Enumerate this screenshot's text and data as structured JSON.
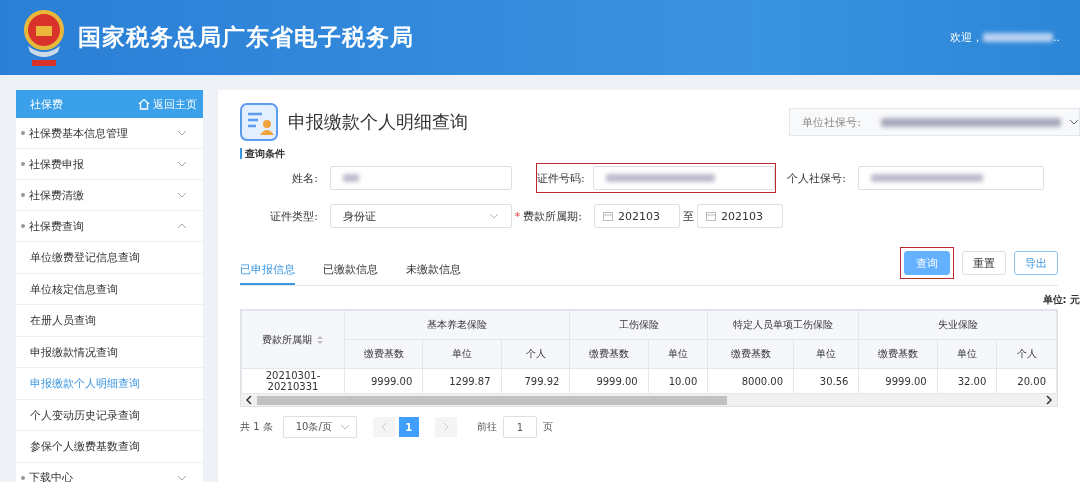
{
  "header": {
    "title": "国家税务总局广东省电子税务局",
    "welcome": "欢迎，",
    "user_blurred": true,
    "ellipsis": ".."
  },
  "sidebar": {
    "title": "社保费",
    "home_link": "返回主页",
    "items": [
      {
        "label": "社保费基本信息管理",
        "expanded": false
      },
      {
        "label": "社保费申报",
        "expanded": false
      },
      {
        "label": "社保费清缴",
        "expanded": false
      },
      {
        "label": "社保费查询",
        "expanded": true,
        "children": [
          {
            "label": "单位缴费登记信息查询",
            "selected": false
          },
          {
            "label": "单位核定信息查询",
            "selected": false
          },
          {
            "label": "在册人员查询",
            "selected": false
          },
          {
            "label": "申报缴款情况查询",
            "selected": false
          },
          {
            "label": "申报缴款个人明细查询",
            "selected": true
          },
          {
            "label": "个人变动历史记录查询",
            "selected": false
          },
          {
            "label": "参保个人缴费基数查询",
            "selected": false
          }
        ]
      },
      {
        "label": "下载中心",
        "expanded": false
      }
    ]
  },
  "page": {
    "title": "申报缴款个人明细查询",
    "unit_label": "单位社保号:",
    "unit_blurred": true
  },
  "query": {
    "section_title": "查询条件",
    "fields": [
      {
        "kind": "text",
        "label": "姓名:",
        "blurred": true,
        "highlighted": false,
        "required": false
      },
      {
        "kind": "text",
        "label": "证件号码:",
        "blurred": true,
        "highlighted": true,
        "required": false
      },
      {
        "kind": "text",
        "label": "个人社保号:",
        "blurred": true,
        "highlighted": false,
        "required": false
      },
      {
        "kind": "select",
        "label": "证件类型:",
        "value": "身份证",
        "highlighted": false,
        "required": false
      },
      {
        "kind": "range",
        "label": "费款所属期:",
        "from": "202103",
        "separator": "至",
        "to": "202103",
        "highlighted": false,
        "required": true,
        "required_mark": "*"
      }
    ]
  },
  "tabs": [
    {
      "label": "已申报信息",
      "selected": true
    },
    {
      "label": "已缴款信息",
      "selected": false
    },
    {
      "label": "未缴款信息",
      "selected": false
    }
  ],
  "buttons": [
    {
      "label": "查询",
      "kind": "primary",
      "highlighted": true
    },
    {
      "label": "重置",
      "kind": "default",
      "highlighted": false
    },
    {
      "label": "导出",
      "kind": "outline",
      "highlighted": false
    }
  ],
  "unit_note": "单位: 元",
  "table": {
    "first_column": "费款所属期",
    "groups": [
      {
        "label": "基本养老保险",
        "columns": [
          "缴费基数",
          "单位",
          "个人"
        ]
      },
      {
        "label": "工伤保险",
        "columns": [
          "缴费基数",
          "单位"
        ]
      },
      {
        "label": "特定人员单项工伤保险",
        "columns": [
          "缴费基数",
          "单位"
        ]
      },
      {
        "label": "失业保险",
        "columns": [
          "缴费基数",
          "单位",
          "个人"
        ]
      }
    ],
    "rows": [
      [
        "20210301-20210331",
        "9999.00",
        "1299.87",
        "799.92",
        "9999.00",
        "10.00",
        "8000.00",
        "30.56",
        "9999.00",
        "32.00",
        "20.00"
      ]
    ]
  },
  "pagination": {
    "total": "共 1 条",
    "page_size": "10条/页",
    "pages": [
      {
        "label": "1",
        "selected": true
      }
    ],
    "goto_label": "前往",
    "goto_value": "1",
    "page_suffix": "页"
  }
}
